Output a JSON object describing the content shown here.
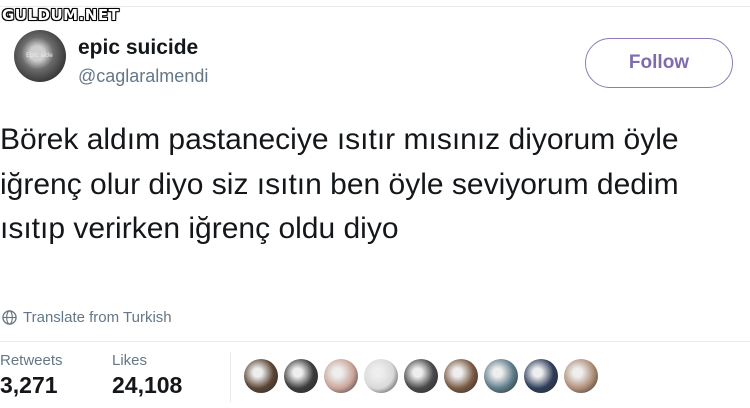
{
  "watermark": "GULDUM.NET",
  "tweet": {
    "display_name": "epic suicide",
    "handle": "@caglaralmendi",
    "avatar_text": "Epic side",
    "follow_label": "Follow",
    "text": "Börek aldım pastaneciye ısıtır mısınız diyorum öyle iğrenç olur diyo siz ısıtın ben öyle seviyorum dedim ısıtıp verirken iğrenç oldu diyo",
    "translate_label": "Translate from Turkish",
    "retweets_label": "Retweets",
    "retweets_value": "3,271",
    "likes_label": "Likes",
    "likes_value": "24,108"
  },
  "colors": {
    "follow_accent": "#7e6cae",
    "secondary_text": "#657786",
    "likers": [
      "#5b4636",
      "#3d3d3d",
      "#c9a59a",
      "#d9d9d9",
      "#4a4a4a",
      "#7a5a45",
      "#5f7c8a",
      "#2f3f5a",
      "#b08f7a"
    ]
  }
}
